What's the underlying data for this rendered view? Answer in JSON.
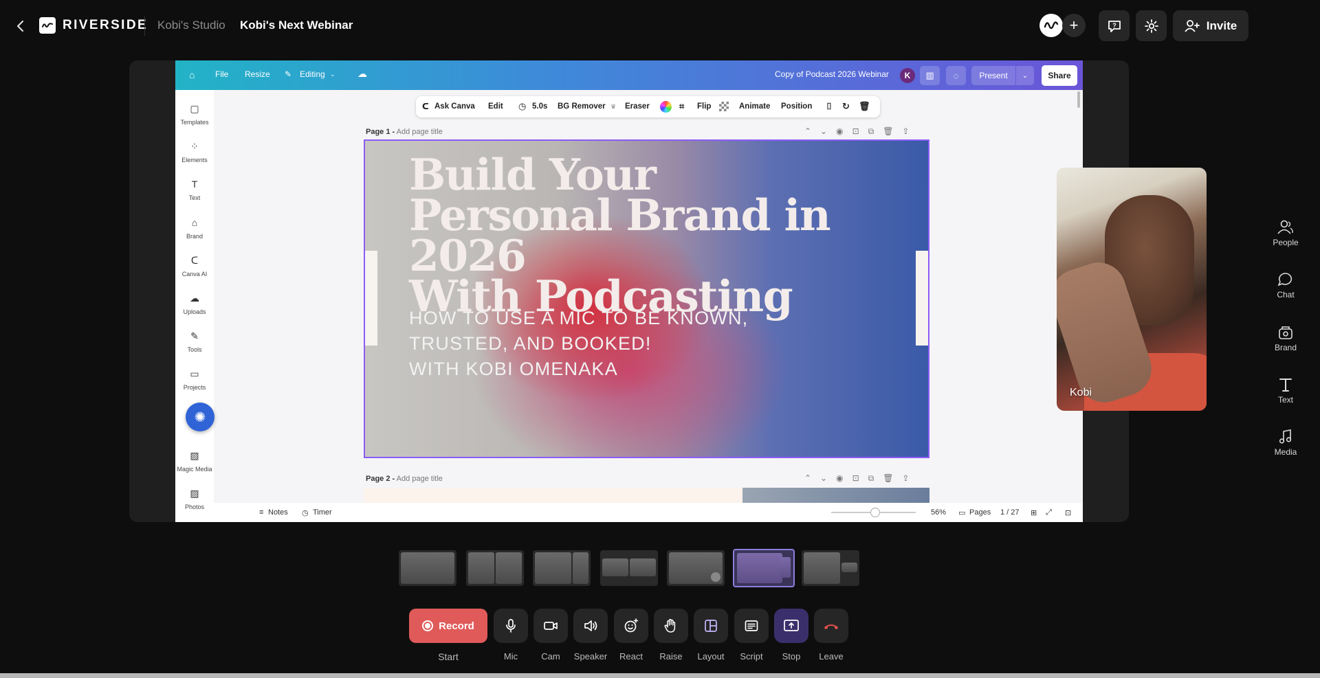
{
  "topbar": {
    "brand": "RIVERSIDE",
    "studio": "Kobi's Studio",
    "session": "Kobi's Next Webinar",
    "invite_label": "Invite"
  },
  "canva": {
    "menu": {
      "file": "File",
      "resize": "Resize",
      "editing": "Editing",
      "doc_title": "Copy of Podcast 2026 Webinar",
      "user_initial": "K",
      "present": "Present",
      "share": "Share"
    },
    "toolbar": {
      "ask": "Ask Canva",
      "edit": "Edit",
      "duration": "5.0s",
      "bg_remover": "BG Remover",
      "eraser": "Eraser",
      "flip": "Flip",
      "animate": "Animate",
      "position": "Position"
    },
    "sidebar": [
      {
        "label": "Templates"
      },
      {
        "label": "Elements"
      },
      {
        "label": "Text"
      },
      {
        "label": "Brand"
      },
      {
        "label": "Canva AI"
      },
      {
        "label": "Uploads"
      },
      {
        "label": "Tools"
      },
      {
        "label": "Projects"
      },
      {
        "label": "Magic Media"
      },
      {
        "label": "Photos"
      }
    ],
    "page1": {
      "label": "Page 1 -",
      "title_placeholder": "Add page title"
    },
    "page2": {
      "label": "Page 2 -",
      "title_placeholder": "Add page title"
    },
    "slide": {
      "title_line1": "Build Your",
      "title_line2": "Personal Brand in 2026",
      "title_line3": "With Podcasting",
      "sub_line1": "HOW TO USE A MIC TO BE KNOWN,",
      "sub_line2": "TRUSTED, AND BOOKED!",
      "sub_line3": "WITH KOBI OMENAKA"
    },
    "bottom": {
      "notes": "Notes",
      "timer": "Timer",
      "zoom": "56%",
      "zoom_level": 0.56,
      "pages": "Pages",
      "page_count": "1 / 27"
    }
  },
  "participant": {
    "name": "Kobi"
  },
  "right_panel": [
    {
      "label": "People",
      "icon": "people-icon"
    },
    {
      "label": "Chat",
      "icon": "chat-icon"
    },
    {
      "label": "Brand",
      "icon": "brand-icon"
    },
    {
      "label": "Text",
      "icon": "text-icon"
    },
    {
      "label": "Media",
      "icon": "media-icon"
    }
  ],
  "layouts": {
    "selected_index": 5,
    "count": 7
  },
  "controls": {
    "record_label": "Record",
    "start_label": "Start",
    "items": [
      {
        "label": "Mic",
        "icon": "mic-icon"
      },
      {
        "label": "Cam",
        "icon": "camera-icon"
      },
      {
        "label": "Speaker",
        "icon": "speaker-icon"
      },
      {
        "label": "React",
        "icon": "react-icon"
      },
      {
        "label": "Raise",
        "icon": "raise-hand-icon"
      },
      {
        "label": "Layout",
        "icon": "layout-icon"
      },
      {
        "label": "Script",
        "icon": "script-icon"
      },
      {
        "label": "Stop",
        "icon": "stop-share-icon"
      },
      {
        "label": "Leave",
        "icon": "leave-icon"
      }
    ]
  },
  "colors": {
    "background": "#0e0e0e",
    "record": "#e05a5a",
    "accent": "#8b5cf6",
    "leave": "#e0504c",
    "stop_bg": "#3b2f6b"
  }
}
